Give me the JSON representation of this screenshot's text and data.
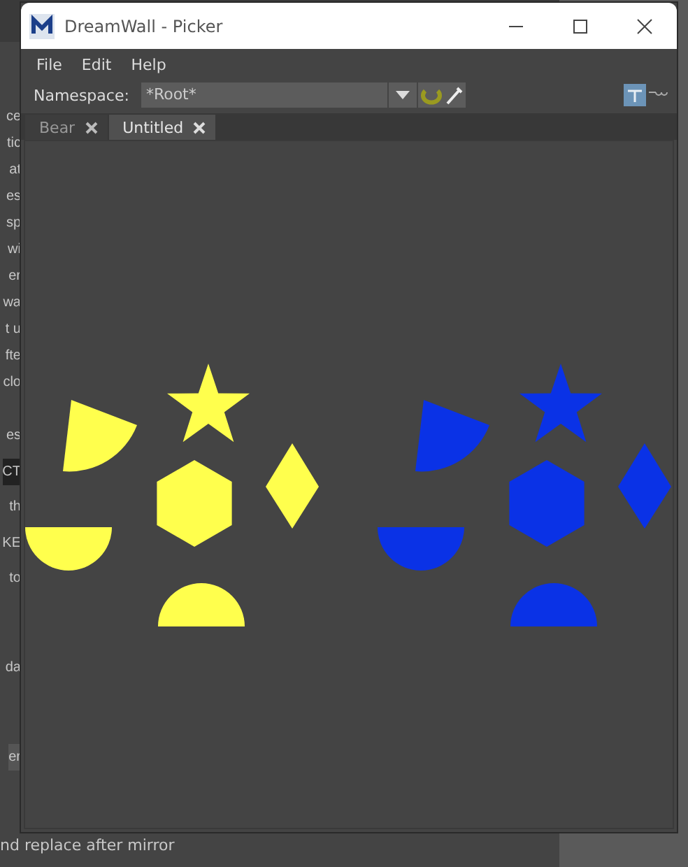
{
  "background_app": {
    "side_texts": [
      "ce",
      "tic",
      "at",
      "es",
      "sp",
      "wi",
      "er",
      "wa",
      "t u",
      "fte",
      "clo",
      "es",
      "CT",
      "th",
      "KE",
      "to",
      "da",
      "er"
    ],
    "bottom_text": "nd replace after mirror"
  },
  "window": {
    "title": "DreamWall - Picker"
  },
  "menu": [
    "File",
    "Edit",
    "Help"
  ],
  "namespace": {
    "label": "Namespace:",
    "value": "*Root*"
  },
  "tabs": [
    {
      "label": "Bear",
      "selected": false
    },
    {
      "label": "Untitled",
      "selected": true
    }
  ],
  "picker_sets": [
    {
      "shapes": [
        {
          "kind": "wedge",
          "color": "#ffff4d"
        },
        {
          "kind": "star",
          "color": "#ffff4d"
        },
        {
          "kind": "hexagon",
          "color": "#ffff4d"
        },
        {
          "kind": "diamond",
          "color": "#ffff4d"
        },
        {
          "kind": "bowl",
          "color": "#ffff4d"
        },
        {
          "kind": "dome",
          "color": "#ffff4d"
        }
      ]
    },
    {
      "shapes": [
        {
          "kind": "wedge",
          "color": "#0a32e6"
        },
        {
          "kind": "star",
          "color": "#0a32e6"
        },
        {
          "kind": "hexagon",
          "color": "#0a32e6"
        },
        {
          "kind": "diamond",
          "color": "#0a32e6"
        },
        {
          "kind": "bowl",
          "color": "#0a32e6"
        },
        {
          "kind": "dome",
          "color": "#0a32e6"
        }
      ]
    }
  ]
}
